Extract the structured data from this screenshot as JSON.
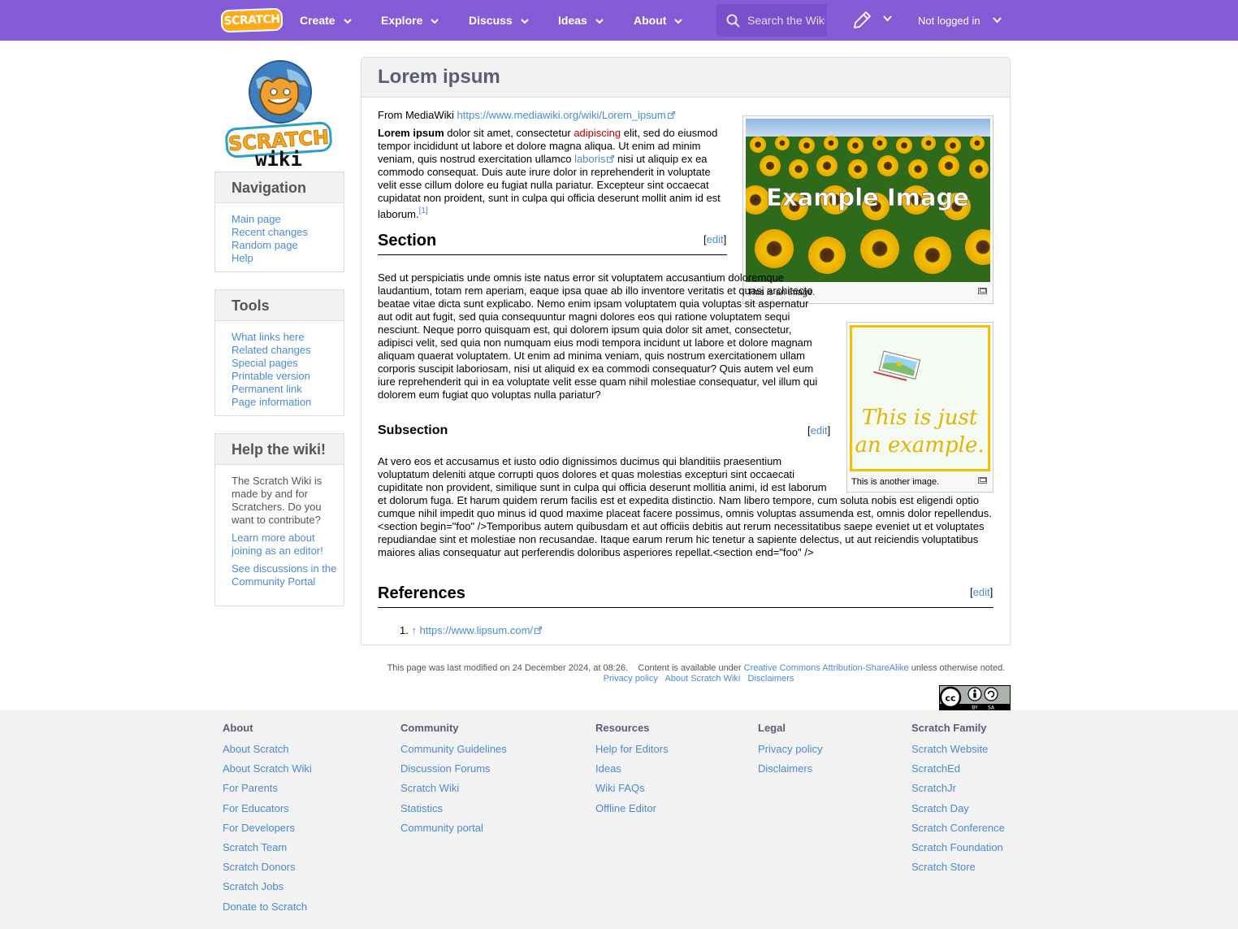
{
  "nav": {
    "logo_text": "SCRATCH",
    "items": [
      "Create",
      "Explore",
      "Discuss",
      "Ideas",
      "About"
    ],
    "search_placeholder": "Search the Wiki",
    "login": "Not logged in",
    "colors": {
      "bar": "#855cd6",
      "search": "#7950cc",
      "logo": "#ffab19"
    }
  },
  "sidebar": {
    "logo_text": "SCRATCH",
    "logo_subtext": "wiki",
    "navigation": {
      "title": "Navigation",
      "items": [
        "Main page",
        "Recent changes",
        "Random page",
        "Help"
      ]
    },
    "tools": {
      "title": "Tools",
      "items": [
        "What links here",
        "Related changes",
        "Special pages",
        "Printable version",
        "Permanent link",
        "Page information"
      ]
    },
    "help": {
      "title": "Help the wiki!",
      "text": "The Scratch Wiki is made by and for Scratchers. Do you want to contribute?",
      "link1": "Learn more about joining as an editor!",
      "link2": "See discussions in the Community Portal"
    }
  },
  "article": {
    "title": "Lorem ipsum",
    "from_label": "From MediaWiki",
    "from_url": "https://www.mediawiki.org/wiki/Lorem_ipsum",
    "p1_bold": "Lorem ipsum",
    "p1_a": " dolor sit amet, consectetur ",
    "p1_red": "adipiscing",
    "p1_b": " elit, sed do eiusmod tempor incididunt ut labore et dolore magna aliqua. Ut enim ad minim veniam, quis nostrud exercitation ullamco ",
    "p1_link": "laboris",
    "p1_c": " nisi ut aliquip ex ea commodo consequat. Duis aute irure dolor in reprehenderit in voluptate velit esse cillum dolore eu fugiat nulla pariatur. Excepteur sint occaecat cupidatat non proident, sunt in culpa qui officia deserunt mollit anim id est laborum.",
    "p1_ref": "[1]",
    "section_title": "Section",
    "edit": "edit",
    "section_text": "Sed ut perspiciatis unde omnis iste natus error sit voluptatem accusantium doloremque laudantium, totam rem aperiam, eaque ipsa quae ab illo inventore veritatis et quasi architecto beatae vitae dicta sunt explicabo. Nemo enim ipsam voluptatem quia voluptas sit aspernatur aut odit aut fugit, sed quia consequuntur magni dolores eos qui ratione voluptatem sequi nesciunt. Neque porro quisquam est, qui dolorem ipsum quia dolor sit amet, consectetur, adipisci velit, sed quia non numquam eius modi tempora incidunt ut labore et dolore magnam aliquam quaerat voluptatem. Ut enim ad minima veniam, quis nostrum exercitationem ullam corporis suscipit laboriosam, nisi ut aliquid ex ea commodi consequatur? Quis autem vel eum iure reprehenderit qui in ea voluptate velit esse quam nihil molestiae consequatur, vel illum qui dolorem eum fugiat quo voluptas nulla pariatur?",
    "subsection_title": "Subsection",
    "subsection_text": "At vero eos et accusamus et iusto odio dignissimos ducimus qui blanditiis praesentium voluptatum deleniti atque corrupti quos dolores et quas molestias excepturi sint occaecati cupiditate non provident, similique sunt in culpa qui officia deserunt mollitia animi, id est laborum et dolorum fuga. Et harum quidem rerum facilis est et expedita distinctio. Nam libero tempore, cum soluta nobis est eligendi optio cumque nihil impedit quo minus id quod maxime placeat facere possimus, omnis voluptas assumenda est, omnis dolor repellendus. <section begin=\"foo\" />Temporibus autem quibusdam et aut officiis debitis aut rerum necessitatibus saepe eveniet ut et voluptates repudiandae sint et molestiae non recusandae. Itaque earum rerum hic tenetur a sapiente delectus, ut aut reiciendis voluptatibus maiores alias consequatur aut perferendis doloribus asperiores repellat.<section end=\"foo\" />",
    "references_title": "References",
    "ref_num": "1.",
    "ref_arrow": "↑",
    "ref_url": "https://www.lipsum.com/",
    "image1_text": "Example Image",
    "image1_caption": "This is an image.",
    "image2_text_1": "This is just",
    "image2_text_2": "an example.",
    "image2_caption": "This is another image."
  },
  "lastmod": {
    "text": "This page was last modified on 24 December 2024, at 08:26.",
    "content_pre": "Content is available under",
    "license": "Creative Commons Attribution-ShareAlike",
    "content_post": "unless otherwise noted.",
    "privacy": "Privacy policy",
    "about": "About Scratch Wiki",
    "disclaimers": "Disclaimers",
    "cc_badge": "cc",
    "cc_by": "BY",
    "cc_sa": "SA"
  },
  "footer": {
    "columns": [
      {
        "title": "About",
        "links": [
          "About Scratch",
          "About Scratch Wiki",
          "For Parents",
          "For Educators",
          "For Developers",
          "Scratch Team",
          "Scratch Donors",
          "Scratch Jobs",
          "Donate to Scratch"
        ]
      },
      {
        "title": "Community",
        "links": [
          "Community Guidelines",
          "Discussion Forums",
          "Scratch Wiki",
          "Statistics",
          "Community portal"
        ]
      },
      {
        "title": "Resources",
        "links": [
          "Help for Editors",
          "Ideas",
          "Wiki FAQs",
          "Offline Editor"
        ]
      },
      {
        "title": "Legal",
        "links": [
          "Privacy policy",
          "Disclaimers"
        ]
      },
      {
        "title": "Scratch Family",
        "links": [
          "Scratch Website",
          "ScratchEd",
          "ScratchJr",
          "Scratch Day",
          "Scratch Conference",
          "Scratch Foundation",
          "Scratch Store"
        ]
      }
    ]
  }
}
